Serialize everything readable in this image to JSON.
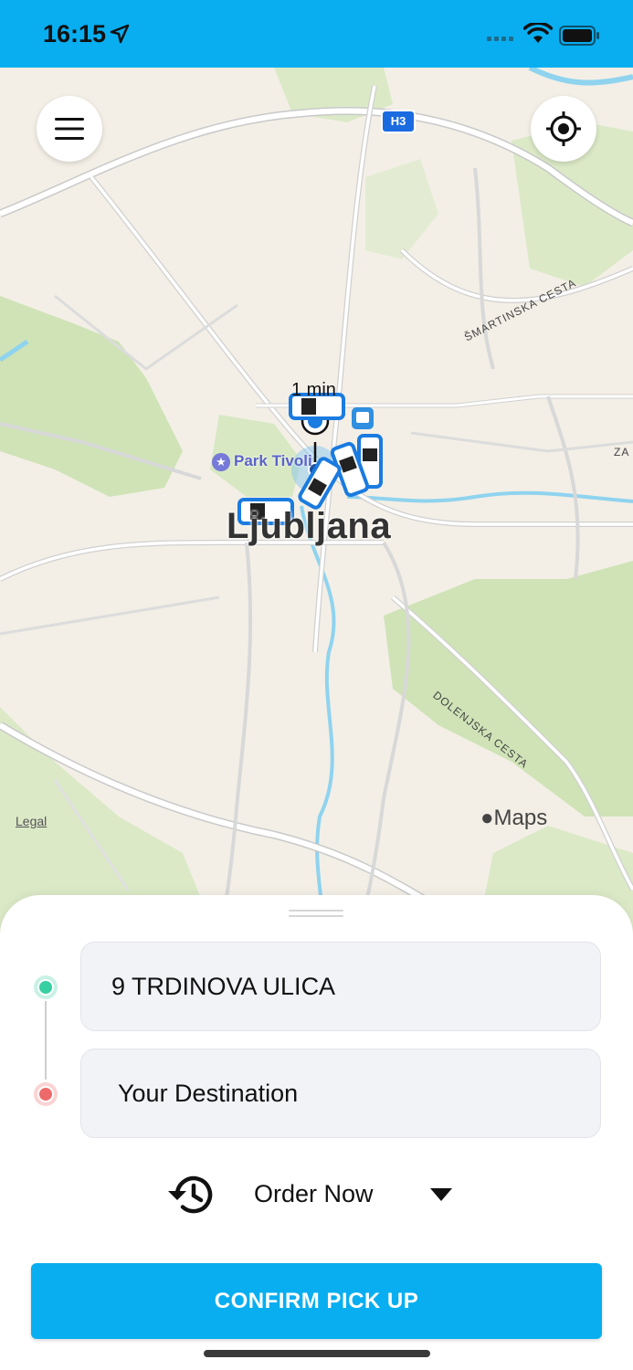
{
  "status_bar": {
    "time": "16:15",
    "icons": [
      "location-arrow-icon",
      "signal-icon",
      "wifi-icon",
      "battery-icon"
    ],
    "background": "#08aef0"
  },
  "map": {
    "city_label": "Ljubljana",
    "poi_label": "Park Tivoli",
    "eta_label": "1 min",
    "highway_badge": "H3",
    "road_labels": [
      "ŠMARTINSKA CESTA",
      "DOLENJSKA CESTA",
      "ZA"
    ],
    "legal_label": "Legal",
    "maps_label": "Maps",
    "menu_icon": "hamburger-menu-icon",
    "locate_icon": "crosshair-locate-icon"
  },
  "booking": {
    "pickup_address": "9 TRDINOVA ULICA",
    "destination_placeholder": "Your Destination",
    "order_time_label": "Order Now",
    "confirm_label": "CONFIRM PICK UP",
    "colors": {
      "accent": "#08aef0",
      "pickup_dot": "#37d0a3",
      "destination_dot": "#ee6a6a"
    }
  }
}
